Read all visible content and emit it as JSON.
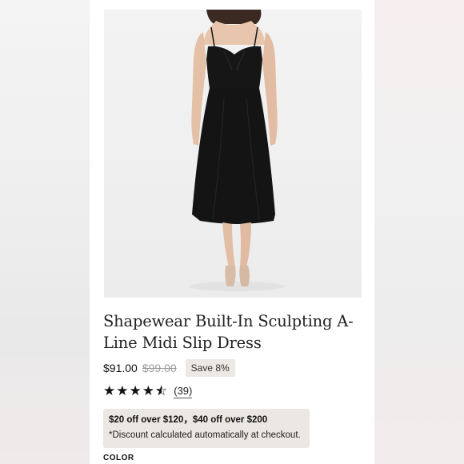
{
  "product": {
    "image_alt": "Model wearing black midi slip dress",
    "title": "Shapewear Built-In Sculpting A-Line Midi Slip Dress",
    "price": "$91.00",
    "original_price": "$99.00",
    "save_badge": "Save 8%",
    "rating": 4.5,
    "review_count": "(39)",
    "promo": {
      "line1": "$20 off over $120，$40 off over $200",
      "line2": "*Discount calculated automatically at checkout."
    },
    "color_label": "COLOR"
  },
  "colors": {
    "dress": "#151515",
    "badge_bg": "#ece8e3",
    "promo_bg": "#ebe7e2"
  }
}
